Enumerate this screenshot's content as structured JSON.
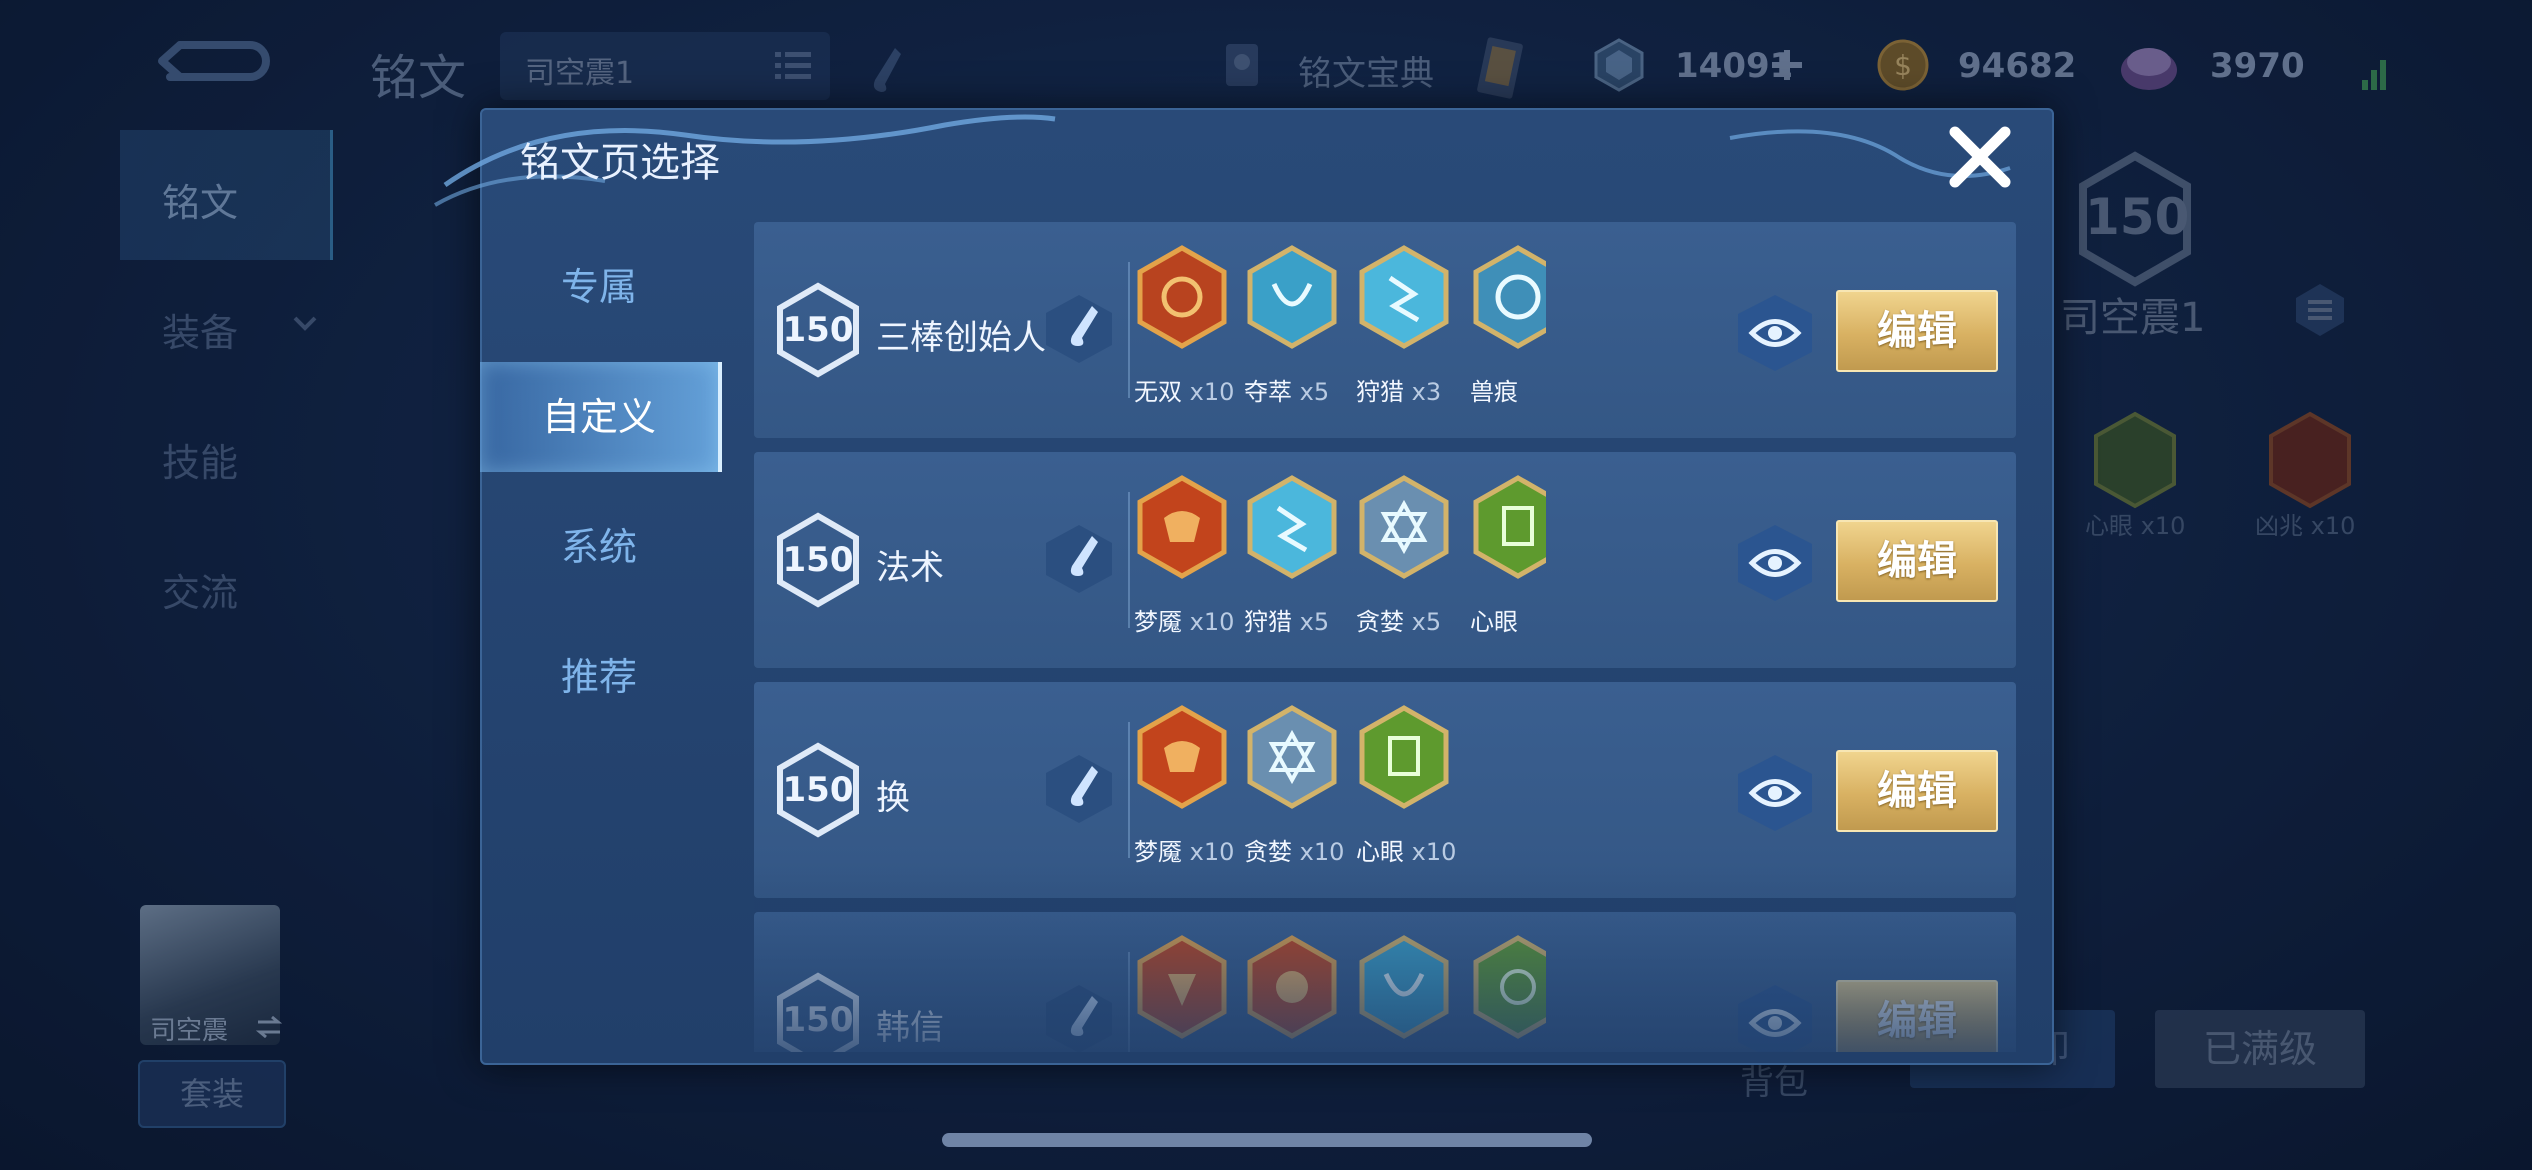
{
  "topbar": {
    "title": "铭文",
    "page_select_label": "司空震1",
    "codex_label": "铭文宝典",
    "currency_1": "14091",
    "currency_2": "94682",
    "currency_3": "3970"
  },
  "leftnav": {
    "items": [
      "铭文",
      "装备",
      "技能",
      "交流"
    ]
  },
  "background": {
    "hero_level": "150",
    "hero_page_name": "司空震1",
    "rune_1_label": "心眼 x10",
    "rune_2_label": "凶兆 x10",
    "avatar_name": "司空震",
    "suit_label": "套装",
    "bag_label": "背包",
    "unload_label": "一键卸",
    "maxed_label": "已满级"
  },
  "modal": {
    "title": "铭文页选择",
    "tabs": [
      "专属",
      "自定义",
      "系统",
      "推荐"
    ],
    "active_tab": "自定义",
    "edit_label": "编辑",
    "rows": [
      {
        "level": "150",
        "name": "三棒创始人",
        "runes": [
          {
            "name": "无双",
            "count": "x10",
            "icon": "red-rune-icon"
          },
          {
            "name": "夺萃",
            "count": "x5",
            "icon": "blue-rune-icon"
          },
          {
            "name": "狩猎",
            "count": "x3",
            "icon": "blue-rune-icon"
          },
          {
            "name": "兽痕",
            "count": "",
            "icon": "blue-rune-icon"
          }
        ]
      },
      {
        "level": "150",
        "name": "法术",
        "runes": [
          {
            "name": "梦魇",
            "count": "x10",
            "icon": "red-rune-icon"
          },
          {
            "name": "狩猎",
            "count": "x5",
            "icon": "blue-rune-icon"
          },
          {
            "name": "贪婪",
            "count": "x5",
            "icon": "blue-rune-icon"
          },
          {
            "name": "心眼",
            "count": "",
            "icon": "green-rune-icon"
          }
        ]
      },
      {
        "level": "150",
        "name": "换",
        "runes": [
          {
            "name": "梦魇",
            "count": "x10",
            "icon": "red-rune-icon"
          },
          {
            "name": "贪婪",
            "count": "x10",
            "icon": "blue-rune-icon"
          },
          {
            "name": "心眼",
            "count": "x10",
            "icon": "green-rune-icon"
          }
        ]
      },
      {
        "level": "150",
        "name": "韩信",
        "runes": [
          {
            "name": "",
            "count": "",
            "icon": "red-rune-icon"
          },
          {
            "name": "",
            "count": "",
            "icon": "red-rune-icon"
          },
          {
            "name": "",
            "count": "",
            "icon": "blue-rune-icon"
          },
          {
            "name": "",
            "count": "",
            "icon": "green-rune-icon"
          }
        ]
      }
    ]
  },
  "colors": {
    "background": "#142a4f",
    "modal": "#264673",
    "edit_gold": "#d8b162",
    "tab_active": "#78bef8"
  }
}
